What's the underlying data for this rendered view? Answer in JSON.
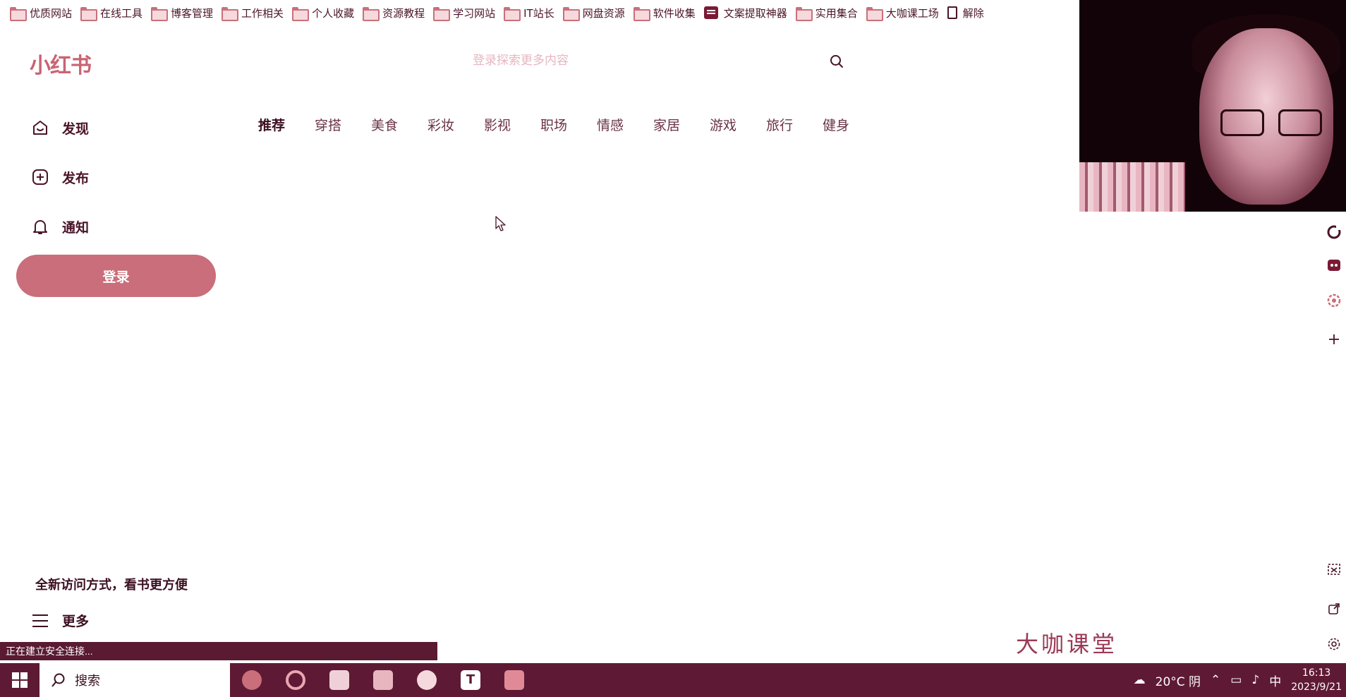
{
  "bookmarks": [
    {
      "label": "优质网站",
      "icon": "folder-icon"
    },
    {
      "label": "在线工具",
      "icon": "folder-icon"
    },
    {
      "label": "博客管理",
      "icon": "folder-icon"
    },
    {
      "label": "工作相关",
      "icon": "folder-icon"
    },
    {
      "label": "个人收藏",
      "icon": "folder-icon"
    },
    {
      "label": "资源教程",
      "icon": "folder-icon"
    },
    {
      "label": "学习网站",
      "icon": "folder-icon"
    },
    {
      "label": "IT站长",
      "icon": "folder-icon"
    },
    {
      "label": "网盘资源",
      "icon": "folder-icon"
    },
    {
      "label": "软件收集",
      "icon": "folder-icon"
    },
    {
      "label": "文案提取神器",
      "icon": "app-icon"
    },
    {
      "label": "实用集合",
      "icon": "folder-icon"
    },
    {
      "label": "大咖课工场",
      "icon": "folder-icon"
    },
    {
      "label": "解除",
      "icon": "document-icon"
    }
  ],
  "header": {
    "logo": "小红书",
    "search_placeholder": "登录探索更多内容"
  },
  "sidebar": {
    "items": [
      {
        "label": "发现",
        "icon": "home-icon"
      },
      {
        "label": "发布",
        "icon": "plus-square-icon"
      },
      {
        "label": "通知",
        "icon": "bell-icon"
      }
    ],
    "login_label": "登录",
    "promo": "全新访问方式，看书更方便",
    "more_label": "更多"
  },
  "tabs": [
    "推荐",
    "穿搭",
    "美食",
    "彩妆",
    "影视",
    "职场",
    "情感",
    "家居",
    "游戏",
    "旅行",
    "健身"
  ],
  "status_bar": "正在建立安全连接...",
  "watermark": "大咖课堂",
  "taskbar": {
    "search_label": "搜索",
    "weather": "20°C 阴",
    "ime": "中",
    "time": "16:13",
    "date": "2023/9/21"
  },
  "colors": {
    "accent": "#c96e7a",
    "text": "#4a1428",
    "taskbar": "#5e1a34"
  }
}
